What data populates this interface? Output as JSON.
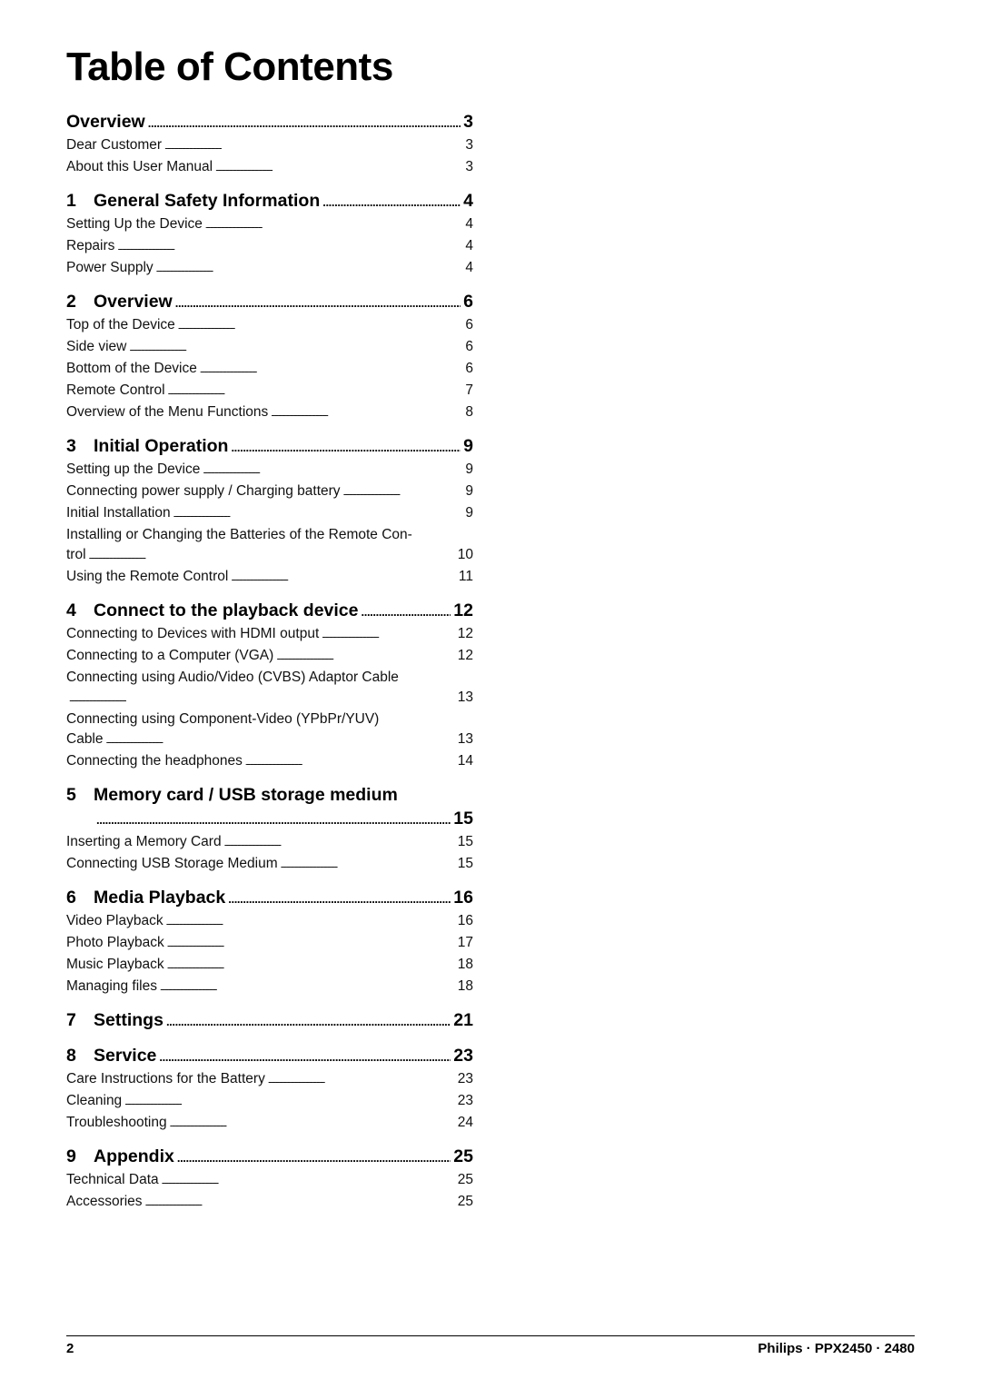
{
  "title": "Table of Contents",
  "sections": [
    {
      "num": "",
      "label": "Overview",
      "page": "3",
      "items": [
        {
          "label": "Dear Customer",
          "page": "3"
        },
        {
          "label": "About this User Manual",
          "page": "3"
        }
      ]
    },
    {
      "num": "1",
      "label": "General Safety Information",
      "page": "4",
      "items": [
        {
          "label": "Setting Up the Device",
          "page": "4"
        },
        {
          "label": "Repairs",
          "page": "4"
        },
        {
          "label": "Power Supply",
          "page": "4"
        }
      ]
    },
    {
      "num": "2",
      "label": "Overview",
      "page": "6",
      "items": [
        {
          "label": "Top of the Device",
          "page": "6"
        },
        {
          "label": "Side view",
          "page": "6"
        },
        {
          "label": "Bottom of the Device",
          "page": "6"
        },
        {
          "label": "Remote Control",
          "page": "7"
        },
        {
          "label": "Overview of the Menu Functions",
          "page": "8"
        }
      ]
    },
    {
      "num": "3",
      "label": "Initial Operation",
      "page": "9",
      "items": [
        {
          "label": "Setting up the Device",
          "page": "9"
        },
        {
          "label": "Connecting power supply / Charging battery",
          "page": "9"
        },
        {
          "label": "Initial Installation",
          "page": "9"
        },
        {
          "label": "Installing or Changing the Batteries of the Remote Con-",
          "cont": "trol",
          "page": "10"
        },
        {
          "label": "Using the Remote Control",
          "page": "11"
        }
      ]
    },
    {
      "num": "4",
      "label": "Connect to the playback device",
      "page": "12",
      "items": [
        {
          "label": "Connecting to Devices with HDMI output",
          "page": "12"
        },
        {
          "label": "Connecting to a Computer (VGA)",
          "page": "12"
        },
        {
          "label": "Connecting using Audio/Video (CVBS) Adaptor Cable",
          "cont": "",
          "page": "13"
        },
        {
          "label": "Connecting using Component-Video (YPbPr/YUV)",
          "cont": "Cable",
          "page": "13"
        },
        {
          "label": "Connecting the headphones",
          "page": "14"
        }
      ]
    },
    {
      "num": "5",
      "label": "Memory card / USB storage medium",
      "page": "15",
      "wrap": true,
      "items": [
        {
          "label": "Inserting a Memory Card",
          "page": "15"
        },
        {
          "label": "Connecting USB Storage Medium",
          "page": "15"
        }
      ]
    },
    {
      "num": "6",
      "label": "Media Playback",
      "page": "16",
      "items": [
        {
          "label": "Video Playback",
          "page": "16"
        },
        {
          "label": "Photo Playback",
          "page": "17"
        },
        {
          "label": "Music Playback",
          "page": "18"
        },
        {
          "label": "Managing files",
          "page": "18"
        }
      ]
    },
    {
      "num": "7",
      "label": "Settings",
      "page": "21",
      "items": []
    },
    {
      "num": "8",
      "label": "Service",
      "page": "23",
      "items": [
        {
          "label": "Care Instructions for the Battery",
          "page": "23"
        },
        {
          "label": "Cleaning",
          "page": "23"
        },
        {
          "label": "Troubleshooting",
          "page": "24"
        }
      ]
    },
    {
      "num": "9",
      "label": "Appendix",
      "page": "25",
      "items": [
        {
          "label": "Technical Data",
          "page": "25"
        },
        {
          "label": "Accessories",
          "page": "25"
        }
      ]
    }
  ],
  "footer": {
    "page_number": "2",
    "brand": "Philips · PPX2450 · 2480"
  }
}
